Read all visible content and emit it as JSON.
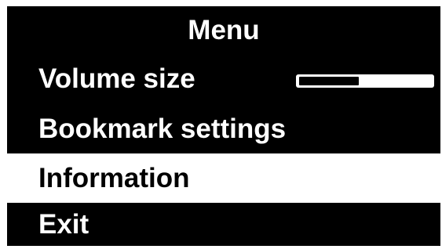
{
  "menu": {
    "title": "Menu",
    "items": [
      {
        "label": "Volume size",
        "selected": false
      },
      {
        "label": "Bookmark settings",
        "selected": false
      },
      {
        "label": "Information",
        "selected": true
      },
      {
        "label": "Exit",
        "selected": false
      }
    ],
    "volume_level": 0.45
  },
  "colors": {
    "background": "#000000",
    "foreground": "#ffffff",
    "selected_background": "#ffffff",
    "selected_foreground": "#000000"
  }
}
